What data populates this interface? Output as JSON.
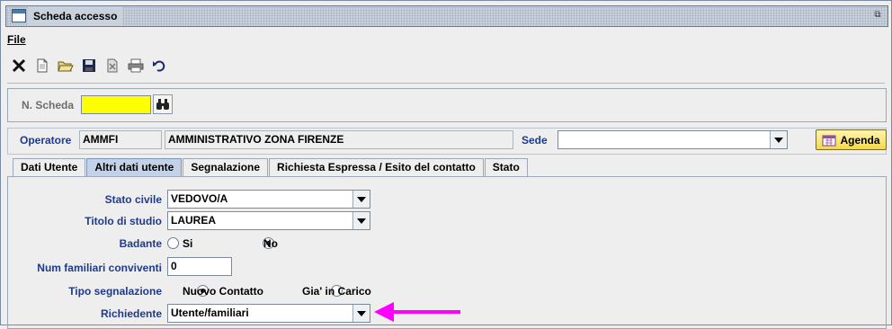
{
  "window": {
    "title": "Scheda accesso"
  },
  "menu": {
    "file": "File"
  },
  "toolbar": {
    "buttons": [
      "close-icon",
      "new-document-icon",
      "open-folder-icon",
      "save-disk-icon",
      "delete-document-icon",
      "print-icon",
      "undo-icon"
    ]
  },
  "scheda": {
    "label": "N. Scheda",
    "value": ""
  },
  "operatore": {
    "label": "Operatore",
    "code": "AMMFI",
    "name": "AMMINISTRATIVO ZONA FIRENZE"
  },
  "sede": {
    "label": "Sede",
    "value": ""
  },
  "agenda_button": "Agenda",
  "tabs": [
    "Dati Utente",
    "Altri dati utente",
    "Segnalazione",
    "Richiesta Espressa / Esito del contatto",
    "Stato"
  ],
  "active_tab": "Altri dati utente",
  "form": {
    "stato_civile": {
      "label": "Stato civile",
      "value": "VEDOVO/A"
    },
    "titolo_studio": {
      "label": "Titolo di studio",
      "value": "LAUREA"
    },
    "badante": {
      "label": "Badante",
      "options": [
        "Si",
        "No"
      ],
      "selected": "No"
    },
    "num_familiari": {
      "label": "Num familiari conviventi",
      "value": "0"
    },
    "tipo_segnalazione": {
      "label": "Tipo segnalazione",
      "options": [
        "Nuovo Contatto",
        "Gia' in Carico"
      ],
      "selected": "Nuovo Contatto"
    },
    "richiedente": {
      "label": "Richiedente",
      "value": "Utente/familiari"
    }
  },
  "colors": {
    "highlight_field": "#ffff00",
    "label_blue": "#1f3a8a",
    "active_tab": "#c3d2e6",
    "annotation_arrow": "#ff00ff"
  }
}
